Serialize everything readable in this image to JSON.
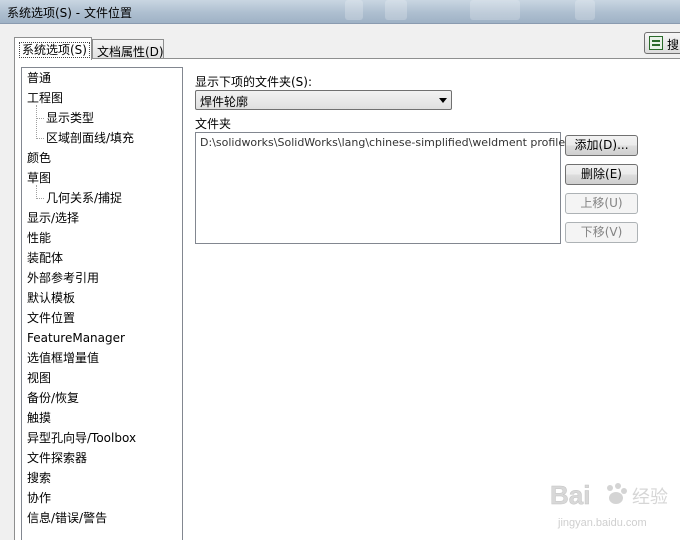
{
  "window": {
    "title": "系统选项(S) - 文件位置"
  },
  "toolbar": {
    "search_label": "搜"
  },
  "tabs": [
    {
      "label": "系统选项(S)",
      "active": true
    },
    {
      "label": "文档属性(D)",
      "active": false
    }
  ],
  "tree": {
    "items": [
      {
        "label": "普通",
        "level": 0
      },
      {
        "label": "工程图",
        "level": 0
      },
      {
        "label": "显示类型",
        "level": 1
      },
      {
        "label": "区域剖面线/填充",
        "level": 1
      },
      {
        "label": "颜色",
        "level": 0
      },
      {
        "label": "草图",
        "level": 0
      },
      {
        "label": "几何关系/捕捉",
        "level": 1
      },
      {
        "label": "显示/选择",
        "level": 0
      },
      {
        "label": "性能",
        "level": 0
      },
      {
        "label": "装配体",
        "level": 0
      },
      {
        "label": "外部参考引用",
        "level": 0
      },
      {
        "label": "默认模板",
        "level": 0
      },
      {
        "label": "文件位置",
        "level": 0,
        "selected": true
      },
      {
        "label": "FeatureManager",
        "level": 0
      },
      {
        "label": "选值框增量值",
        "level": 0
      },
      {
        "label": "视图",
        "level": 0
      },
      {
        "label": "备份/恢复",
        "level": 0
      },
      {
        "label": "触摸",
        "level": 0
      },
      {
        "label": "异型孔向导/Toolbox",
        "level": 0
      },
      {
        "label": "文件探索器",
        "level": 0
      },
      {
        "label": "搜索",
        "level": 0
      },
      {
        "label": "协作",
        "level": 0
      },
      {
        "label": "信息/错误/警告",
        "level": 0
      }
    ]
  },
  "content": {
    "show_folders_for_label": "显示下项的文件夹(S):",
    "show_folders_for_value": "焊件轮廓",
    "folders_label": "文件夹",
    "folders": [
      "D:\\solidworks\\SolidWorks\\lang\\chinese-simplified\\weldment profiles"
    ],
    "buttons": {
      "add": "添加(D)...",
      "delete": "删除(E)",
      "move_up": "上移(U)",
      "move_down": "下移(V)"
    }
  },
  "watermark": {
    "brand": "Bai",
    "brand2": "经验",
    "url": "jingyan.baidu.com"
  }
}
